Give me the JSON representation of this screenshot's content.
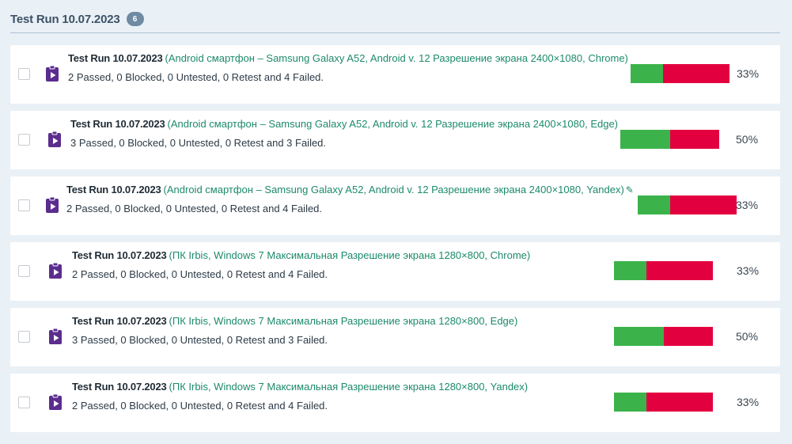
{
  "header": {
    "title": "Test Run 10.07.2023",
    "count": "6"
  },
  "runs": [
    {
      "name": "Test Run 10.07.2023",
      "config": "(Android смартфон – Samsung Galaxy A52, Android v. 12 Разрешение экрана 2400×1080, Chrome)",
      "stats": "2 Passed, 0 Blocked, 0 Untested, 0 Retest and 4 Failed.",
      "passed_fraction": 0.33,
      "percent": "33%",
      "editable": false
    },
    {
      "name": "Test Run 10.07.2023",
      "config": "(Android смартфон – Samsung Galaxy A52, Android v. 12 Разрешение экрана 2400×1080, Edge)",
      "stats": "3 Passed, 0 Blocked, 0 Untested, 0 Retest and 3 Failed.",
      "passed_fraction": 0.5,
      "percent": "50%",
      "editable": false
    },
    {
      "name": "Test Run 10.07.2023",
      "config": "(Android смартфон – Samsung Galaxy A52, Android v. 12 Разрешение экрана 2400×1080, Yandex)",
      "stats": "2 Passed, 0 Blocked, 0 Untested, 0 Retest and 4 Failed.",
      "passed_fraction": 0.33,
      "percent": "33%",
      "editable": true
    },
    {
      "name": "Test Run 10.07.2023",
      "config": "(ПК Irbis, Windows 7 Максимальная Разрешение экрана 1280×800, Chrome)",
      "stats": "2 Passed, 0 Blocked, 0 Untested, 0 Retest and 4 Failed.",
      "passed_fraction": 0.33,
      "percent": "33%",
      "editable": false
    },
    {
      "name": "Test Run 10.07.2023",
      "config": "(ПК Irbis, Windows 7 Максимальная Разрешение экрана 1280×800, Edge)",
      "stats": "3 Passed, 0 Blocked, 0 Untested, 0 Retest and 3 Failed.",
      "passed_fraction": 0.5,
      "percent": "50%",
      "editable": false
    },
    {
      "name": "Test Run 10.07.2023",
      "config": "(ПК Irbis, Windows 7 Максимальная Разрешение экрана 1280×800, Yandex)",
      "stats": "2 Passed, 0 Blocked, 0 Untested, 0 Retest and 4 Failed.",
      "passed_fraction": 0.33,
      "percent": "33%",
      "editable": false
    }
  ],
  "colors": {
    "passed": "#3bb34a",
    "failed": "#e3003f",
    "config_text": "#1c8a6b",
    "icon": "#5b2d8e"
  },
  "icons": {
    "run": "clipboard-play-icon",
    "edit": "pencil-icon"
  }
}
